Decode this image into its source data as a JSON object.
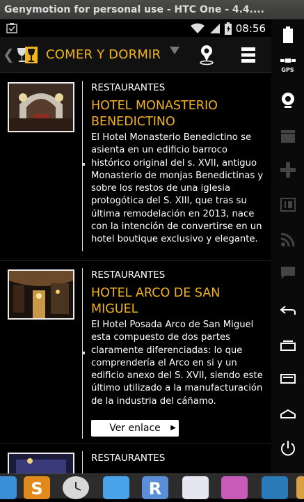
{
  "window": {
    "title": "Genymotion for personal use - HTC One - 4.4...."
  },
  "status_bar": {
    "time": "08:56"
  },
  "app_bar": {
    "back_glyph": "❮",
    "title": "COMER Y DORMIR"
  },
  "items": [
    {
      "category": "RESTAURANTES",
      "title": "HOTEL MONASTERIO BENEDICTINO",
      "description": "El Hotel Monasterio Benedictino se asienta en un edificio barroco histórico original del s. XVII,  antiguo Monasterio de monjas Benedictinas y sobre los restos de una iglesia protogótica del S. XIII, que tras su última remodelación en 2013, nace con la intención de convertirse en un hotel boutique exclusivo  y elegante."
    },
    {
      "category": "RESTAURANTES",
      "title": "HOTEL ARCO DE SAN MIGUEL",
      "description": "El Hotel Posada Arco de San Miguel esta compuesto de dos partes claramente diferenciadas: lo que comprendería el Arco en si y un edificio anexo del S. XVII, siendo este último utilizado a la manufacturación de la industria del cáñamo.",
      "link_label": "Ver enlace"
    },
    {
      "category": "RESTAURANTES"
    }
  ],
  "sidebar": {
    "gps_label": "GPS"
  },
  "colors": {
    "accent": "#f2b41c",
    "background": "#000000"
  }
}
